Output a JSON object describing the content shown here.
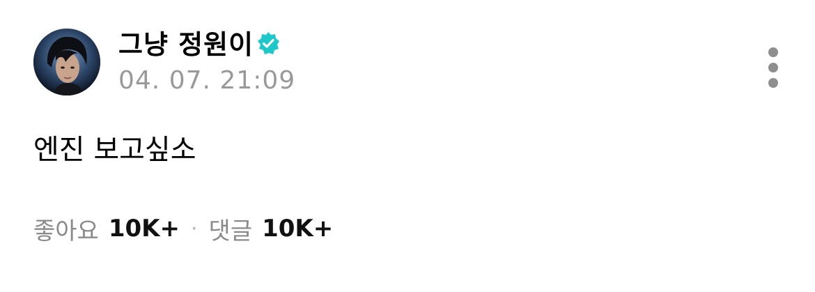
{
  "author": {
    "name": "그냥 정원이",
    "verified": true,
    "verified_color": "#1ec8c8"
  },
  "timestamp": "04. 07. 21:09",
  "post": {
    "text": "엔진 보고싶소"
  },
  "stats": {
    "likes_label": "좋아요",
    "likes_value": "10K+",
    "separator": "·",
    "comments_label": "댓글",
    "comments_value": "10K+"
  },
  "icons": {
    "more": "more-vertical-icon",
    "verified": "verified-badge-icon"
  }
}
